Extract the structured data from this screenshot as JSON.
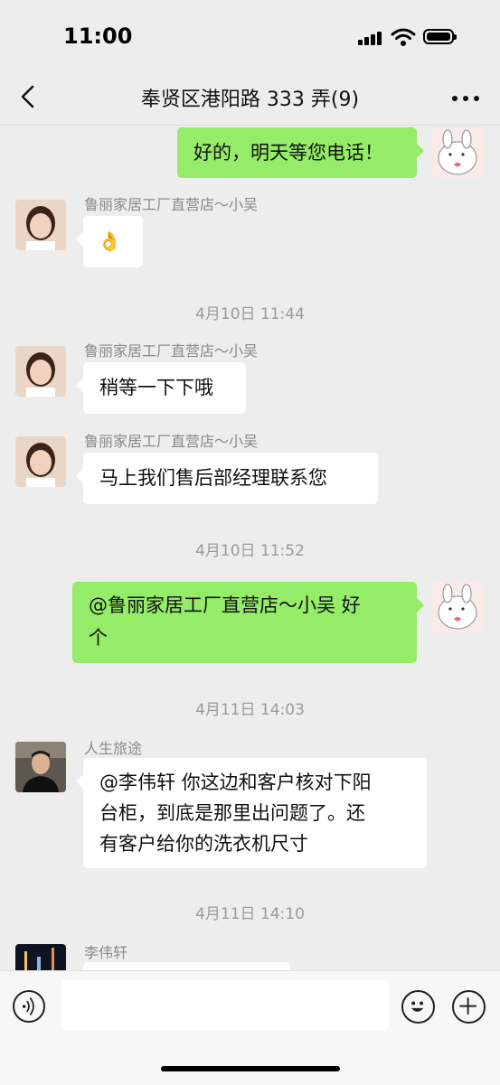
{
  "status_bar": {
    "time": "11:00"
  },
  "nav": {
    "title": "奉贤区港阳路 333 弄(9)",
    "back_icon": "chevron-left-icon",
    "more_icon": "more-dots-icon"
  },
  "messages": [
    {
      "type": "out",
      "text": "好的，明天等您电话！"
    },
    {
      "type": "in",
      "sender": "鲁丽家居工厂直营店～小吴",
      "text": "👌"
    },
    {
      "type": "time",
      "text": "4月10日 11:44"
    },
    {
      "type": "in",
      "sender": "鲁丽家居工厂直营店～小吴",
      "text": "稍等一下下哦"
    },
    {
      "type": "in",
      "sender": "鲁丽家居工厂直营店～小吴",
      "text": "马上我们售后部经理联系您"
    },
    {
      "type": "time",
      "text": "4月10日 11:52"
    },
    {
      "type": "out",
      "lines": [
        "@鲁丽家居工厂直营店～小吴 好",
        "个"
      ]
    },
    {
      "type": "time",
      "text": "4月11日 14:03"
    },
    {
      "type": "in",
      "sender": "人生旅途",
      "lines": [
        "@李伟轩 你这边和客户核对下阳",
        "台柜，到底是那里出问题了。还",
        "有客户给你的洗衣机尺寸"
      ]
    },
    {
      "type": "time",
      "text": "4月11日 14:10"
    },
    {
      "type": "in",
      "sender": "李伟轩",
      "text": ""
    }
  ],
  "input_bar": {
    "value": "",
    "placeholder": "",
    "voice_icon": "voice-icon",
    "emoji_icon": "emoji-icon",
    "plus_icon": "plus-icon"
  },
  "colors": {
    "background": "#ededed",
    "outgoing_bubble": "#95ec69",
    "incoming_bubble": "#ffffff",
    "timestamp": "#9b9b9b"
  }
}
